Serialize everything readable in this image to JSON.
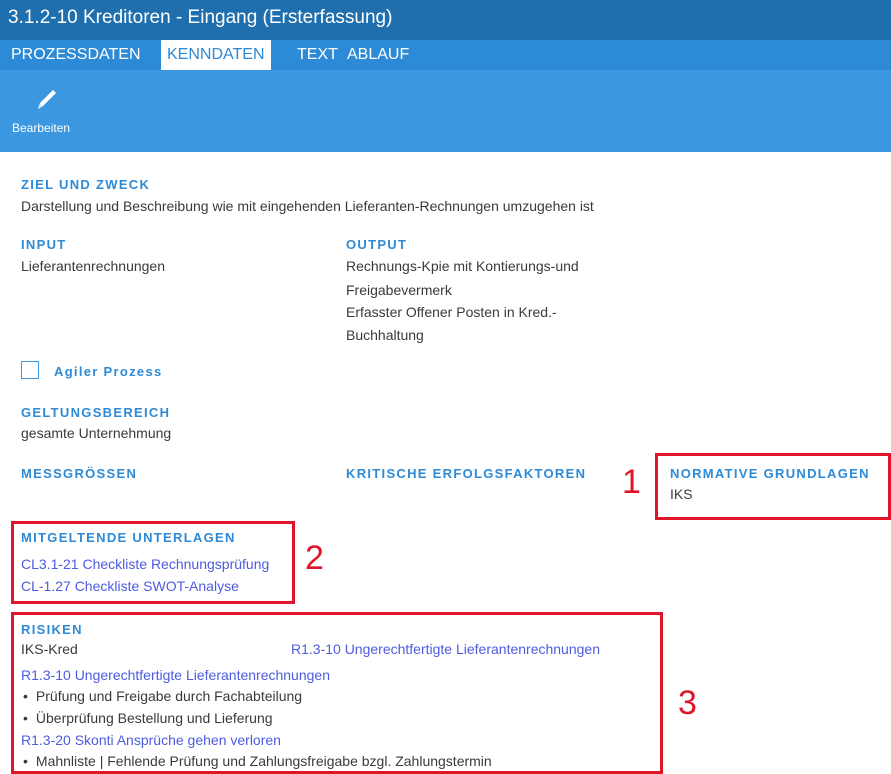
{
  "window": {
    "title": "3.1.2-10 Kreditoren - Eingang (Ersterfassung)"
  },
  "tabs": [
    {
      "label": "PROZESSDATEN",
      "active": false
    },
    {
      "label": "KENNDATEN",
      "active": true
    },
    {
      "label": "TEXT",
      "active": false
    },
    {
      "label": "ABLAUF",
      "active": false
    }
  ],
  "toolbar": {
    "edit_label": "Bearbeiten",
    "edit_icon": "pencil-icon"
  },
  "ziel": {
    "heading": "ZIEL UND ZWECK",
    "text": "Darstellung und Beschreibung wie mit eingehenden Lieferanten-Rechnungen umzugehen ist"
  },
  "input": {
    "heading": "INPUT",
    "text": "Lieferantenrechnungen"
  },
  "output": {
    "heading": "OUTPUT",
    "lines": [
      "Rechnungs-Kpie mit Kontierungs-und",
      "Freigabevermerk",
      "Erfasster Offener Posten in Kred.-",
      "Buchhaltung"
    ]
  },
  "agile": {
    "label": "Agiler Prozess",
    "checked": false
  },
  "geltung": {
    "heading": "GELTUNGSBEREICH",
    "text": "gesamte Unternehmung"
  },
  "messgroessen": {
    "heading": "MESSGRÖSSEN"
  },
  "kritisch": {
    "heading": "KRITISCHE ERFOLGSFAKTOREN"
  },
  "normative": {
    "heading": "NORMATIVE GRUNDLAGEN",
    "text": "IKS"
  },
  "mitgeltende": {
    "heading": "MITGELTENDE UNTERLAGEN",
    "links": [
      "CL3.1-21 Checkliste Rechnungsprüfung",
      "CL-1.27 Checkliste SWOT-Analyse"
    ]
  },
  "risiken": {
    "heading": "RISIKEN",
    "category": "IKS-Kred",
    "category_link": "R1.3-10 Ungerechtfertigte Lieferantenrechnungen",
    "items": [
      {
        "link": "R1.3-10 Ungerechtfertigte Lieferantenrechnungen",
        "bullets": [
          "Prüfung und Freigabe durch Fachabteilung",
          "Überprüfung Bestellung und Lieferung"
        ]
      },
      {
        "link": "R1.3-20 Skonti Ansprüche gehen verloren",
        "bullets": [
          "Mahnliste | Fehlende Prüfung und Zahlungsfreigabe bzgl. Zahlungstermin"
        ]
      }
    ]
  },
  "annotations": {
    "one": "1",
    "two": "2",
    "three": "3"
  },
  "colors": {
    "titlebar": "#1f6fae",
    "tabs": "#2d8ad6",
    "toolbar": "#3a97e0",
    "heading": "#2d8ad6",
    "link": "#4d5be0",
    "annotation": "#e0152a"
  }
}
